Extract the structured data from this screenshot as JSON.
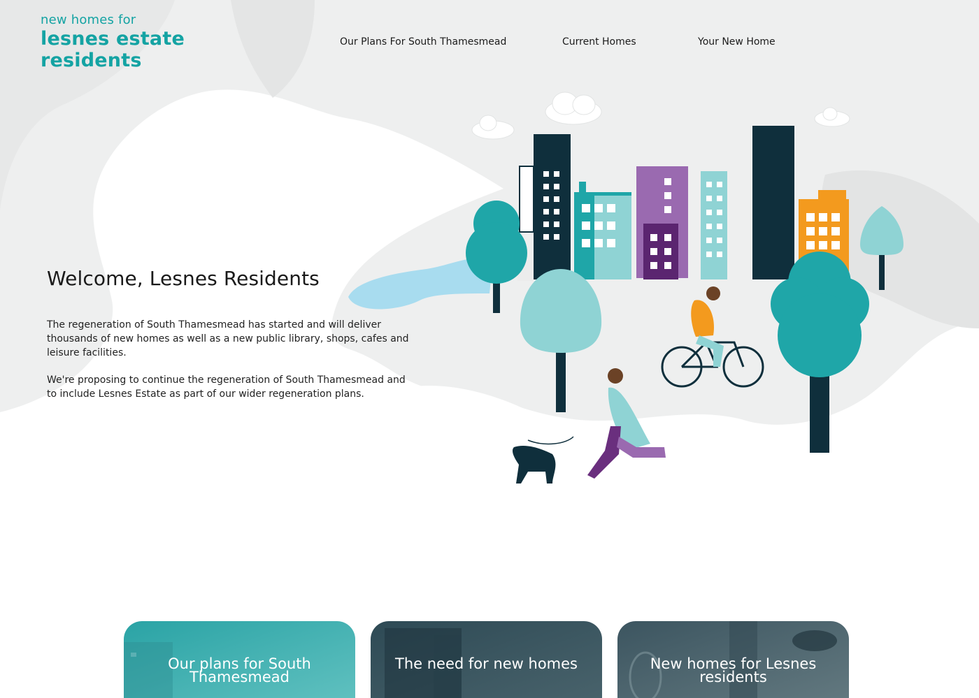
{
  "logo": {
    "tagline": "new homes for",
    "line1": "lesnes estate",
    "line2": "residents"
  },
  "nav": {
    "items": [
      {
        "label": "Our Plans For South Thamesmead"
      },
      {
        "label": "Current Homes"
      },
      {
        "label": "Your New Home"
      }
    ]
  },
  "hero": {
    "title": "Welcome, Lesnes Residents",
    "paragraph1": "The regeneration of South Thamesmead has started and will deliver thousands of new homes as well as a new public library, shops, cafes and leisure facilities.",
    "paragraph2": "We're proposing to continue the regeneration of South Thamesmead and to include Lesnes Estate as part of our wider regeneration plans."
  },
  "cards": [
    {
      "title": "Our plans for South Thamesmead"
    },
    {
      "title": "The need for new homes"
    },
    {
      "title": "New homes for Lesnes residents"
    }
  ],
  "colors": {
    "brand": "#14a3a3",
    "teal": "#1fa6a8",
    "light_teal": "#8fd3d4",
    "purple": "#6a2f7e",
    "orange": "#f39a1e",
    "navy": "#0f2f3c"
  }
}
